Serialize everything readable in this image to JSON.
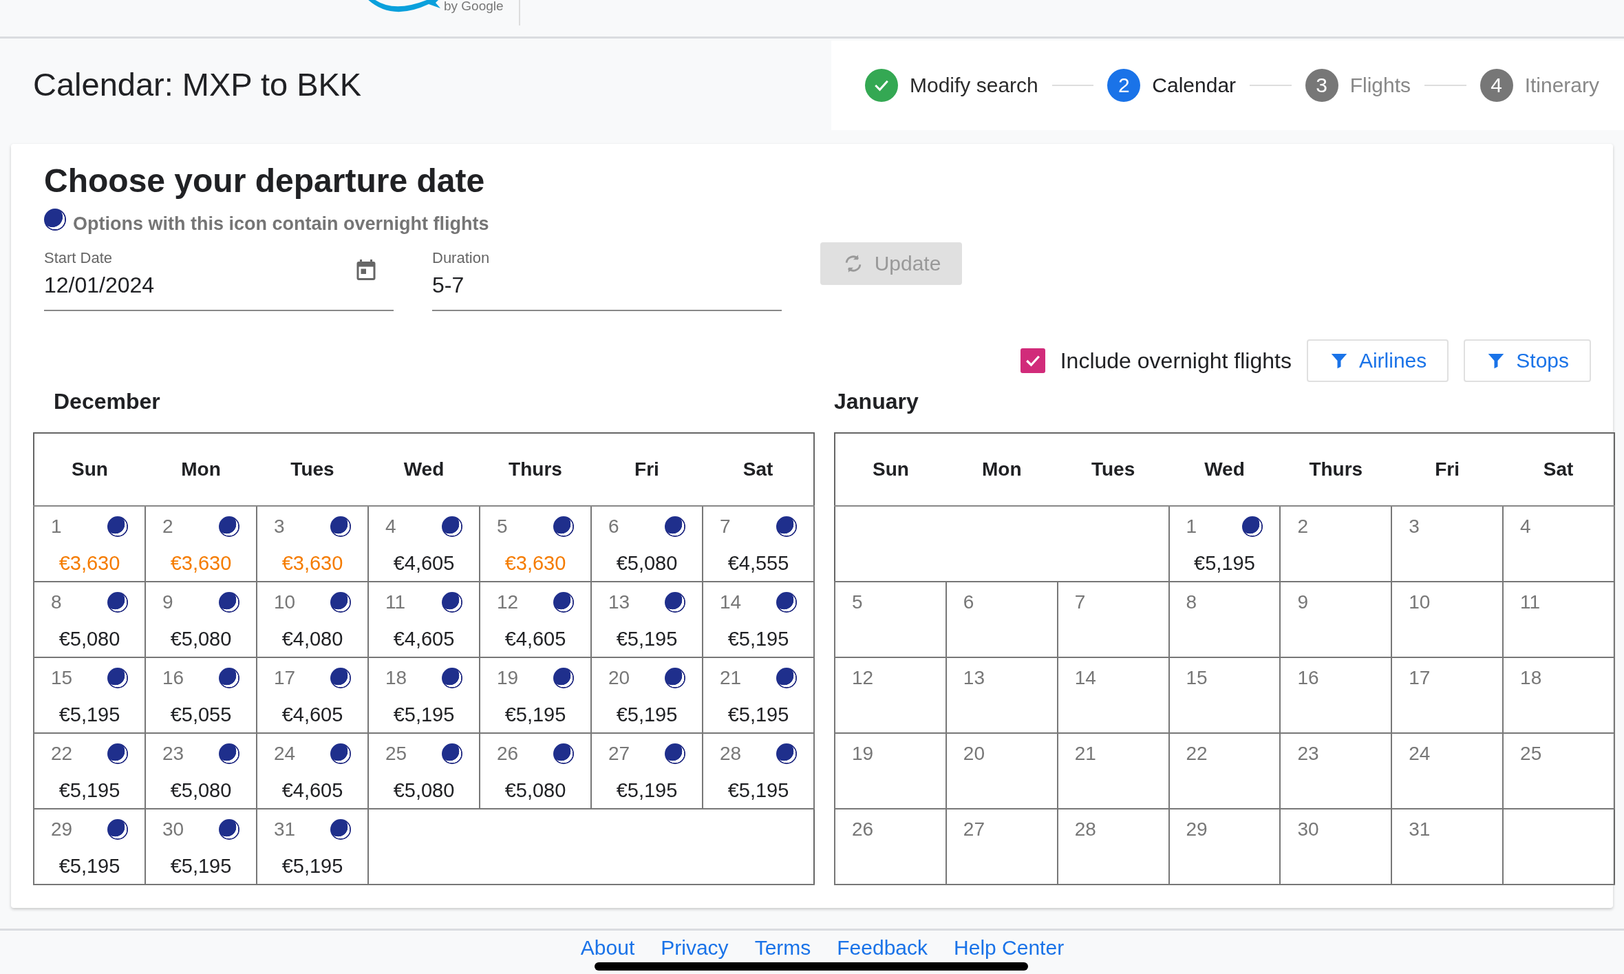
{
  "header": {
    "logo_caption": "by Google"
  },
  "page_title": "Calendar: MXP to BKK",
  "steps": [
    {
      "label": "Modify search",
      "completed": true,
      "selected": false
    },
    {
      "number": "2",
      "label": "Calendar",
      "completed": false,
      "selected": true
    },
    {
      "number": "3",
      "label": "Flights",
      "completed": false,
      "selected": false
    },
    {
      "number": "4",
      "label": "Itinerary",
      "completed": false,
      "selected": false
    }
  ],
  "heading": "Choose your departure date",
  "legend": "Options with this icon contain overnight flights",
  "start_date": {
    "label": "Start Date",
    "value": "12/01/2024"
  },
  "duration": {
    "label": "Duration",
    "value": "5-7"
  },
  "update_button": {
    "label": "Update",
    "disabled": true
  },
  "overnight_filter": {
    "label": "Include overnight flights",
    "checked": true
  },
  "filter_buttons": [
    "Airlines",
    "Stops"
  ],
  "months": [
    {
      "name": "December",
      "weekdays": [
        "Sun",
        "Mon",
        "Tues",
        "Wed",
        "Thurs",
        "Fri",
        "Sat"
      ],
      "weeks": [
        [
          {
            "kind": "day",
            "day": "1",
            "overnight": true,
            "price": "€3,630",
            "cheapest": true
          },
          {
            "kind": "day",
            "day": "2",
            "overnight": true,
            "price": "€3,630",
            "cheapest": true
          },
          {
            "kind": "day",
            "day": "3",
            "overnight": true,
            "price": "€3,630",
            "cheapest": true
          },
          {
            "kind": "day",
            "day": "4",
            "overnight": true,
            "price": "€4,605",
            "cheapest": false
          },
          {
            "kind": "day",
            "day": "5",
            "overnight": true,
            "price": "€3,630",
            "cheapest": true
          },
          {
            "kind": "day",
            "day": "6",
            "overnight": true,
            "price": "€5,080",
            "cheapest": false
          },
          {
            "kind": "day",
            "day": "7",
            "overnight": true,
            "price": "€4,555",
            "cheapest": false
          }
        ],
        [
          {
            "kind": "day",
            "day": "8",
            "overnight": true,
            "price": "€5,080",
            "cheapest": false
          },
          {
            "kind": "day",
            "day": "9",
            "overnight": true,
            "price": "€5,080",
            "cheapest": false
          },
          {
            "kind": "day",
            "day": "10",
            "overnight": true,
            "price": "€4,080",
            "cheapest": false
          },
          {
            "kind": "day",
            "day": "11",
            "overnight": true,
            "price": "€4,605",
            "cheapest": false
          },
          {
            "kind": "day",
            "day": "12",
            "overnight": true,
            "price": "€4,605",
            "cheapest": false
          },
          {
            "kind": "day",
            "day": "13",
            "overnight": true,
            "price": "€5,195",
            "cheapest": false
          },
          {
            "kind": "day",
            "day": "14",
            "overnight": true,
            "price": "€5,195",
            "cheapest": false
          }
        ],
        [
          {
            "kind": "day",
            "day": "15",
            "overnight": true,
            "price": "€5,195",
            "cheapest": false
          },
          {
            "kind": "day",
            "day": "16",
            "overnight": true,
            "price": "€5,055",
            "cheapest": false
          },
          {
            "kind": "day",
            "day": "17",
            "overnight": true,
            "price": "€4,605",
            "cheapest": false
          },
          {
            "kind": "day",
            "day": "18",
            "overnight": true,
            "price": "€5,195",
            "cheapest": false
          },
          {
            "kind": "day",
            "day": "19",
            "overnight": true,
            "price": "€5,195",
            "cheapest": false
          },
          {
            "kind": "day",
            "day": "20",
            "overnight": true,
            "price": "€5,195",
            "cheapest": false
          },
          {
            "kind": "day",
            "day": "21",
            "overnight": true,
            "price": "€5,195",
            "cheapest": false
          }
        ],
        [
          {
            "kind": "day",
            "day": "22",
            "overnight": true,
            "price": "€5,195",
            "cheapest": false
          },
          {
            "kind": "day",
            "day": "23",
            "overnight": true,
            "price": "€5,080",
            "cheapest": false
          },
          {
            "kind": "day",
            "day": "24",
            "overnight": true,
            "price": "€4,605",
            "cheapest": false
          },
          {
            "kind": "day",
            "day": "25",
            "overnight": true,
            "price": "€5,080",
            "cheapest": false
          },
          {
            "kind": "day",
            "day": "26",
            "overnight": true,
            "price": "€5,080",
            "cheapest": false
          },
          {
            "kind": "day",
            "day": "27",
            "overnight": true,
            "price": "€5,195",
            "cheapest": false
          },
          {
            "kind": "day",
            "day": "28",
            "overnight": true,
            "price": "€5,195",
            "cheapest": false
          }
        ],
        [
          {
            "kind": "day",
            "day": "29",
            "overnight": true,
            "price": "€5,195",
            "cheapest": false
          },
          {
            "kind": "day",
            "day": "30",
            "overnight": true,
            "price": "€5,195",
            "cheapest": false
          },
          {
            "kind": "day",
            "day": "31",
            "overnight": true,
            "price": "€5,195",
            "cheapest": false
          },
          {
            "kind": "blank"
          },
          {
            "kind": "blank"
          },
          {
            "kind": "blank"
          },
          {
            "kind": "blank"
          }
        ]
      ]
    },
    {
      "name": "January",
      "weekdays": [
        "Sun",
        "Mon",
        "Tues",
        "Wed",
        "Thurs",
        "Fri",
        "Sat"
      ],
      "weeks": [
        [
          {
            "kind": "blank"
          },
          {
            "kind": "blank"
          },
          {
            "kind": "blank"
          },
          {
            "kind": "day",
            "day": "1",
            "overnight": true,
            "price": "€5,195",
            "cheapest": false
          },
          {
            "kind": "day",
            "day": "2",
            "overnight": false
          },
          {
            "kind": "day",
            "day": "3",
            "overnight": false
          },
          {
            "kind": "day",
            "day": "4",
            "overnight": false
          }
        ],
        [
          {
            "kind": "day",
            "day": "5",
            "overnight": false
          },
          {
            "kind": "day",
            "day": "6",
            "overnight": false
          },
          {
            "kind": "day",
            "day": "7",
            "overnight": false
          },
          {
            "kind": "day",
            "day": "8",
            "overnight": false
          },
          {
            "kind": "day",
            "day": "9",
            "overnight": false
          },
          {
            "kind": "day",
            "day": "10",
            "overnight": false
          },
          {
            "kind": "day",
            "day": "11",
            "overnight": false
          }
        ],
        [
          {
            "kind": "day",
            "day": "12",
            "overnight": false
          },
          {
            "kind": "day",
            "day": "13",
            "overnight": false
          },
          {
            "kind": "day",
            "day": "14",
            "overnight": false
          },
          {
            "kind": "day",
            "day": "15",
            "overnight": false
          },
          {
            "kind": "day",
            "day": "16",
            "overnight": false
          },
          {
            "kind": "day",
            "day": "17",
            "overnight": false
          },
          {
            "kind": "day",
            "day": "18",
            "overnight": false
          }
        ],
        [
          {
            "kind": "day",
            "day": "19",
            "overnight": false
          },
          {
            "kind": "day",
            "day": "20",
            "overnight": false
          },
          {
            "kind": "day",
            "day": "21",
            "overnight": false
          },
          {
            "kind": "day",
            "day": "22",
            "overnight": false
          },
          {
            "kind": "day",
            "day": "23",
            "overnight": false
          },
          {
            "kind": "day",
            "day": "24",
            "overnight": false
          },
          {
            "kind": "day",
            "day": "25",
            "overnight": false
          }
        ],
        [
          {
            "kind": "day",
            "day": "26",
            "overnight": false
          },
          {
            "kind": "day",
            "day": "27",
            "overnight": false
          },
          {
            "kind": "day",
            "day": "28",
            "overnight": false
          },
          {
            "kind": "day",
            "day": "29",
            "overnight": false
          },
          {
            "kind": "day",
            "day": "30",
            "overnight": false
          },
          {
            "kind": "day",
            "day": "31",
            "overnight": false
          },
          {
            "kind": "blank"
          }
        ]
      ]
    }
  ],
  "footer_links": [
    "About",
    "Privacy",
    "Terms",
    "Feedback",
    "Help Center"
  ]
}
